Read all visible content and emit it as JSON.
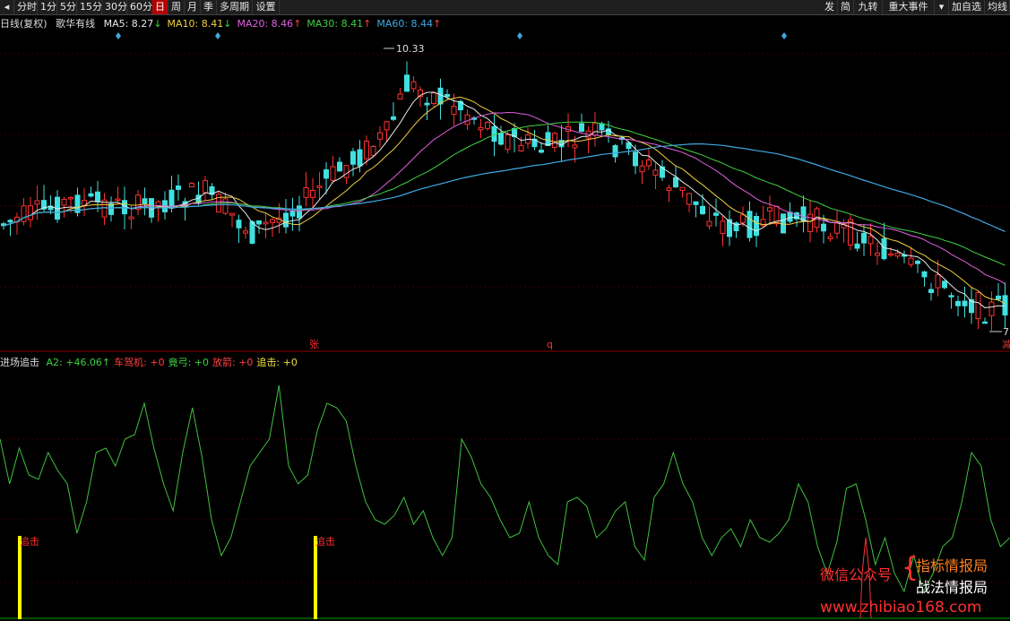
{
  "toolbar": {
    "left_tabs": [
      "分时",
      "1分",
      "5分",
      "15分",
      "30分",
      "60分",
      "日",
      "周",
      "月",
      "季",
      "多周期",
      "设置"
    ],
    "active_tab": "日",
    "right_tabs": [
      "发",
      "简",
      "九转",
      "重大事件",
      "▾",
      "加自选",
      "均线"
    ]
  },
  "main_panel": {
    "indicator_prefix": "日线(复权)",
    "stock_name": "歌华有线",
    "ma": [
      {
        "label": "MA5: 8.27",
        "arrow": "↓",
        "color": "#e8e8e8"
      },
      {
        "label": "MA10: 8.41",
        "arrow": "↓",
        "color": "#f0d040"
      },
      {
        "label": "MA20: 8.46",
        "arrow": "↑",
        "color": "#e060e0"
      },
      {
        "label": "MA30: 8.41",
        "arrow": "↑",
        "color": "#40d040"
      },
      {
        "label": "MA60: 8.44",
        "arrow": "↑",
        "color": "#40a8e0"
      }
    ],
    "high_label": "10.33",
    "low_label": "7",
    "marker_zhang": "张",
    "marker_q": "q",
    "marker_right": "减"
  },
  "sub_panel": {
    "title": "进场追击",
    "fields": [
      {
        "label": "A2: +46.06",
        "arrow": "↑",
        "color": "#40d040"
      },
      {
        "label": "车驾机: +0",
        "arrow": "",
        "color": "#ff4040"
      },
      {
        "label": "竟弓: +0",
        "arrow": "",
        "color": "#40d040"
      },
      {
        "label": "放箭: +0",
        "arrow": "",
        "color": "#ff4040"
      },
      {
        "label": "追击: +0",
        "arrow": "",
        "color": "#f0e040"
      }
    ],
    "signal_labels": [
      "追击",
      "追击"
    ]
  },
  "watermark": {
    "wechat": "微信公众号",
    "name1": "指标情报局",
    "name2": "战法情报局",
    "url": "www.zhibiao168.com"
  },
  "colors": {
    "up": "#ff3030",
    "down": "#40e0e0",
    "ma5": "#e8e8e8",
    "ma10": "#f0d040",
    "ma20": "#e060e0",
    "ma30": "#40d040",
    "ma60": "#40a8e0",
    "a2": "#40c040",
    "signal": "#ffff00"
  }
}
